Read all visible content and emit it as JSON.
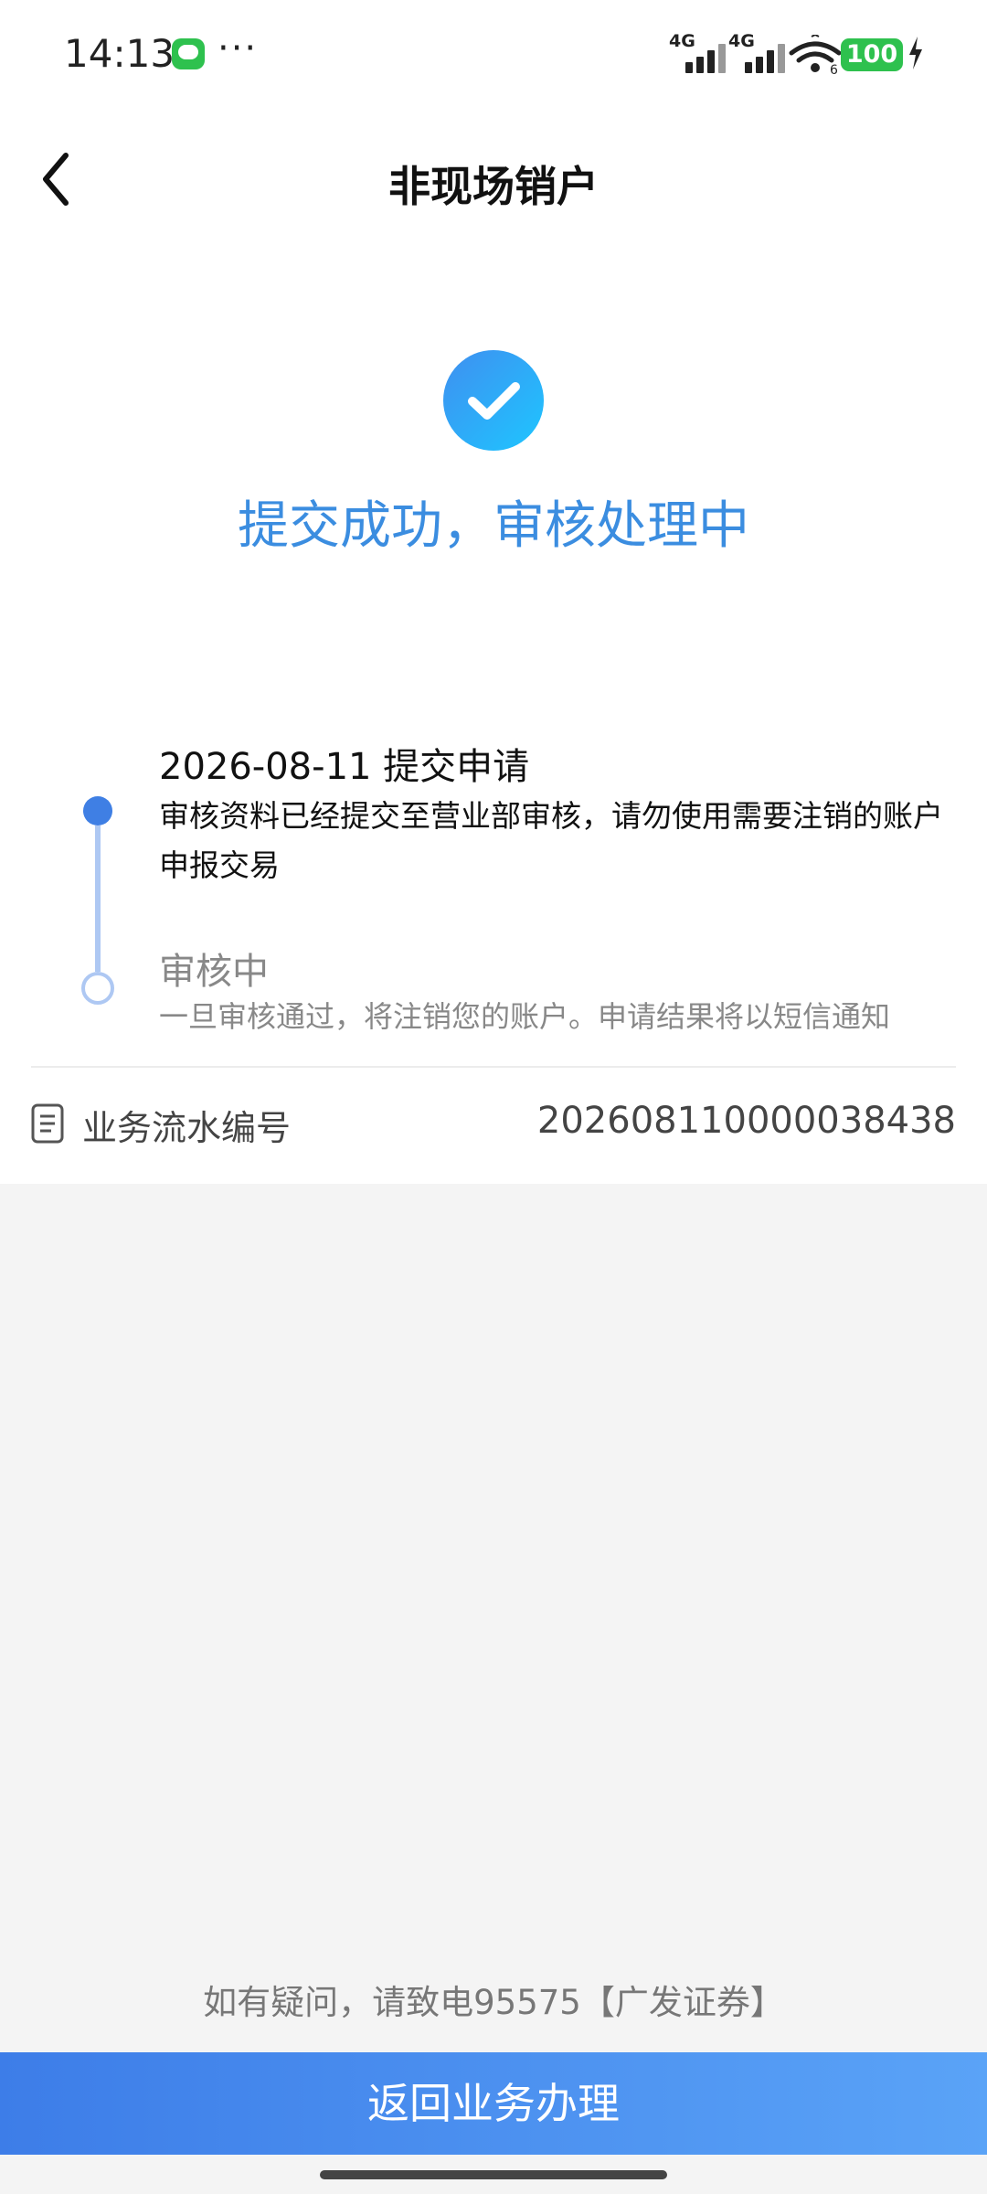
{
  "status_bar": {
    "time": "14:13",
    "more": "···",
    "signal1": "4G",
    "signal2": "4G",
    "wifi_badge": "6",
    "battery": "100"
  },
  "nav": {
    "title": "非现场销户"
  },
  "result": {
    "message": "提交成功，审核处理中"
  },
  "timeline": [
    {
      "title": "2026-08-11 提交申请",
      "desc": "审核资料已经提交至营业部审核，请勿使用需要注销的账户申报交易"
    },
    {
      "title": "审核中",
      "desc": "一旦审核通过，将注销您的账户。申请结果将以短信通知"
    }
  ],
  "serial": {
    "label": "业务流水编号",
    "value": "202608110000038438"
  },
  "footer": {
    "contact": "如有疑问，请致电95575【广发证券】",
    "button": "返回业务办理"
  },
  "colors": {
    "accent": "#3b8de0",
    "button_start": "#3d7de8",
    "button_end": "#5aa3f7",
    "timeline": "#3f7fe4"
  }
}
